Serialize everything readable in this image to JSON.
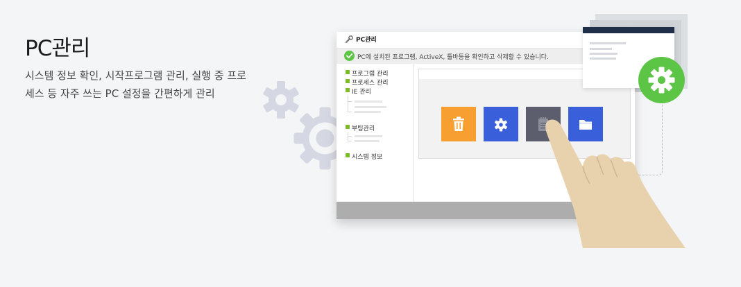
{
  "hero": {
    "title": "PC관리",
    "description": "시스템 정보 확인, 시작프로그램 관리, 실행 중 프로세스 등 자주 쓰는 PC 설정을 간편하게 관리"
  },
  "window": {
    "title": "PC관리",
    "title_icon": "wrench-icon",
    "info_icon": "check-circle-icon",
    "info_text": "PC에 설치된 프로그램, ActiveX, 툴바등을 확인하고 삭제할 수 있습니다.",
    "sidebar": {
      "items": [
        {
          "label": "프로그램 관리"
        },
        {
          "label": "프로세스 관리"
        },
        {
          "label": "IE 관리"
        },
        {
          "label": "부팅관리"
        },
        {
          "label": "시스템 정보"
        }
      ]
    },
    "tiles": [
      {
        "icon": "trash-icon",
        "color": "#f7a031"
      },
      {
        "icon": "gear-icon",
        "color": "#3a5fdb"
      },
      {
        "icon": "notepad-icon",
        "color": "#5c5e6e"
      },
      {
        "icon": "folder-icon",
        "color": "#3a5fdb"
      }
    ]
  },
  "colors": {
    "accent_green": "#5cc545",
    "bullet_green": "#7dbb2a",
    "doc_header": "#1f2f4a"
  }
}
